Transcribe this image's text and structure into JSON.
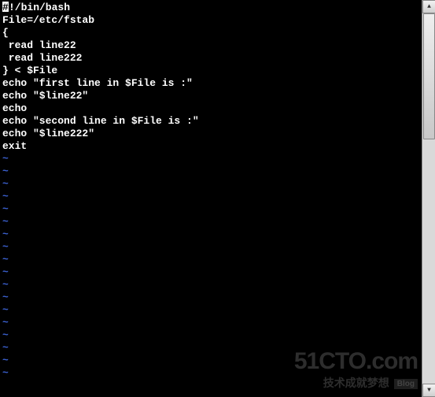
{
  "editor": {
    "cursor_char": "#",
    "lines": [
      "!/bin/bash",
      "File=/etc/fstab",
      "{",
      " read line22",
      " read line222",
      "} < $File",
      "echo \"first line in $File is :\"",
      "echo \"$line22\"",
      "echo",
      "echo \"second line in $File is :\"",
      "echo \"$line222\"",
      "exit"
    ],
    "tilde_rows": 18,
    "tilde_char": "~"
  },
  "scrollbar": {
    "up": "▲",
    "down": "▼"
  },
  "watermark": {
    "main": "51CTO.com",
    "sub": "技术成就梦想",
    "blog": "Blog"
  }
}
